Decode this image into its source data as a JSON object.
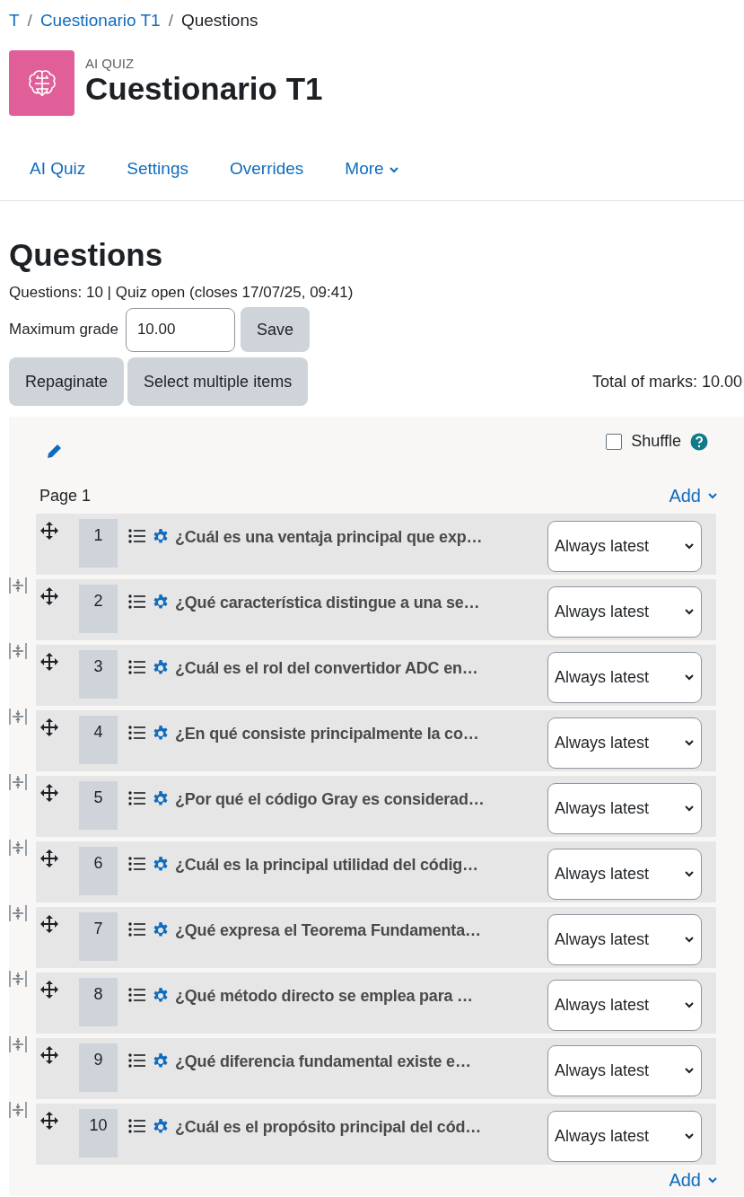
{
  "breadcrumb": [
    {
      "label": "T",
      "kind": "link"
    },
    {
      "label": "/",
      "kind": "separator"
    },
    {
      "label": "Cuestionario T1",
      "kind": "link"
    },
    {
      "label": "/",
      "kind": "separator"
    },
    {
      "label": "Questions",
      "kind": "current"
    }
  ],
  "activity": {
    "type_label": "AI QUIZ",
    "title": "Cuestionario T1"
  },
  "nav_tabs": [
    {
      "label": "AI Quiz",
      "selected": false,
      "kind": "link"
    },
    {
      "label": "Settings",
      "selected": false,
      "kind": "link"
    },
    {
      "label": "Overrides",
      "selected": false,
      "kind": "link"
    },
    {
      "label": "More",
      "selected": false,
      "kind": "dropdown"
    }
  ],
  "heading": "Questions",
  "summary": "Questions: 10 | Quiz open (closes 17/07/25, 09:41)",
  "max_grade": {
    "label": "Maximum grade",
    "value": "10.00",
    "button": "Save"
  },
  "actions": [
    "Repaginate",
    "Select multiple items"
  ],
  "total_marks": "Total of marks: 10.00",
  "section": {
    "shuffle": {
      "label": "Shuffle",
      "checked": false
    },
    "page_label": "Page 1",
    "add_top": "Add",
    "add_bottom": "Add",
    "questions": [
      {
        "number": "1",
        "text": "¿Cuál es una ventaja principal que exp…",
        "version": "Always latest"
      },
      {
        "number": "2",
        "text": "¿Qué característica distingue a una se…",
        "version": "Always latest"
      },
      {
        "number": "3",
        "text": "¿Cuál es el rol del convertidor ADC en…",
        "version": "Always latest"
      },
      {
        "number": "4",
        "text": "¿En qué consiste principalmente la co…",
        "version": "Always latest"
      },
      {
        "number": "5",
        "text": "¿Por qué el código Gray es considerad…",
        "version": "Always latest"
      },
      {
        "number": "6",
        "text": "¿Cuál es la principal utilidad del códig…",
        "version": "Always latest"
      },
      {
        "number": "7",
        "text": "¿Qué expresa el Teorema Fundamenta…",
        "version": "Always latest"
      },
      {
        "number": "8",
        "text": "¿Qué método directo se emplea para …",
        "version": "Always latest"
      },
      {
        "number": "9",
        "text": "¿Qué diferencia fundamental existe e…",
        "version": "Always latest"
      },
      {
        "number": "10",
        "text": "¿Cuál es el propósito principal del cód…",
        "version": "Always latest"
      }
    ]
  }
}
